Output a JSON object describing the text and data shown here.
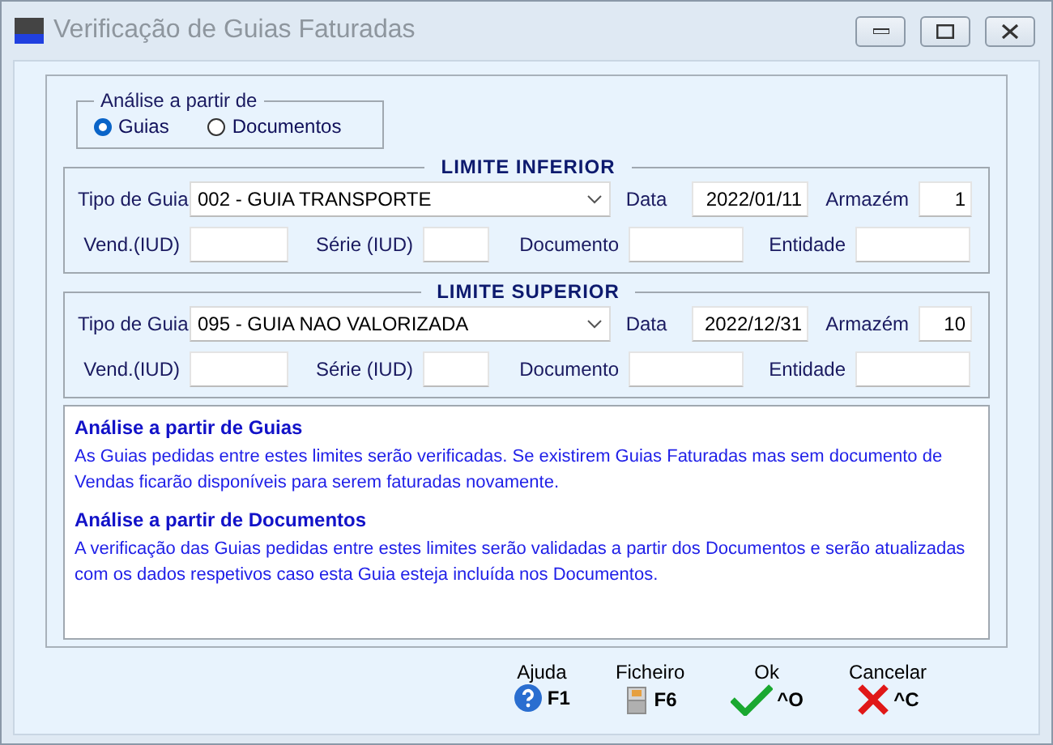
{
  "window": {
    "title": "Verificação de Guias Faturadas"
  },
  "analysis": {
    "legend": "Análise a partir de",
    "options": [
      {
        "label": "Guias",
        "selected": true
      },
      {
        "label": "Documentos",
        "selected": false
      }
    ]
  },
  "limits": [
    {
      "title": "LIMITE INFERIOR",
      "guide_type_label": "Tipo de Guia",
      "guide_type": "002 - GUIA TRANSPORTE",
      "date_label": "Data",
      "date": "2022/01/11",
      "warehouse_label": "Armazém",
      "warehouse": "1",
      "fields": [
        {
          "label": "Vend.(IUD)"
        },
        {
          "label": "Série (IUD)"
        },
        {
          "label": "Documento"
        },
        {
          "label": "Entidade"
        }
      ]
    },
    {
      "title": "LIMITE SUPERIOR",
      "guide_type_label": "Tipo de Guia",
      "guide_type": "095 - GUIA NAO VALORIZADA",
      "date_label": "Data",
      "date": "2022/12/31",
      "warehouse_label": "Armazém",
      "warehouse": "10",
      "fields": [
        {
          "label": "Vend.(IUD)"
        },
        {
          "label": "Série (IUD)"
        },
        {
          "label": "Documento"
        },
        {
          "label": "Entidade"
        }
      ]
    }
  ],
  "info": [
    {
      "heading": "Análise a partir de Guias",
      "text": "As Guias pedidas entre estes limites serão verificadas.  Se existirem Guias Faturadas mas sem documento de Vendas ficarão disponíveis para serem faturadas novamente."
    },
    {
      "heading": "Análise a partir de Documentos",
      "text": "A verificação das Guias pedidas entre estes limites serão validadas a partir dos Documentos e serão atualizadas com os dados respetivos caso esta Guia esteja incluída nos Documentos."
    }
  ],
  "buttons": [
    {
      "label": "Ajuda",
      "kind": "help",
      "key": "F1"
    },
    {
      "label": "Ficheiro",
      "kind": "file",
      "key": "F6"
    },
    {
      "label": "Ok",
      "kind": "ok",
      "key": "^O"
    },
    {
      "label": "Cancelar",
      "kind": "cancel",
      "key": "^C"
    }
  ]
}
